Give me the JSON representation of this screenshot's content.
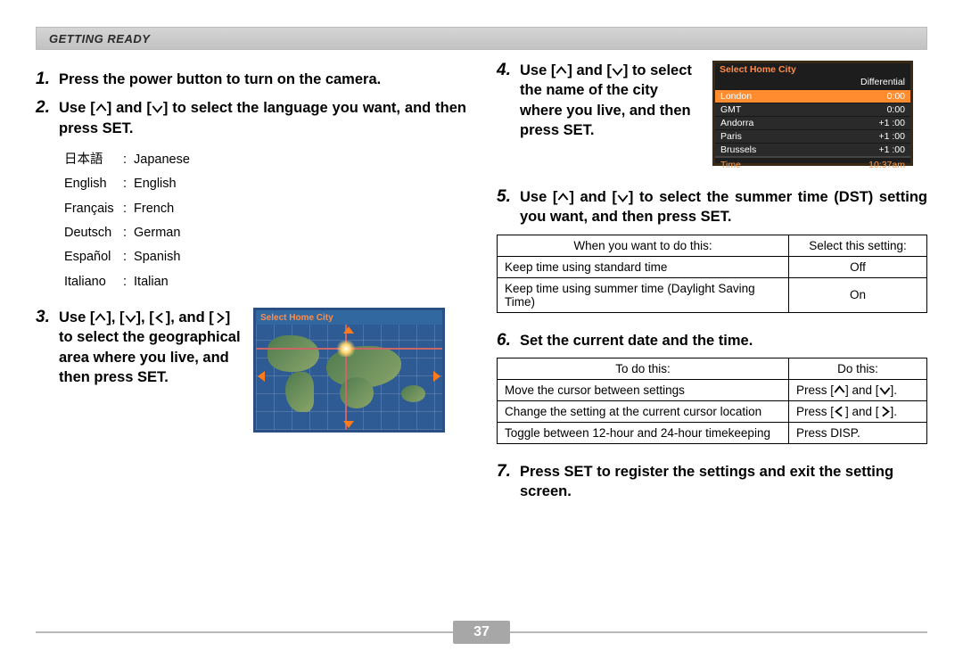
{
  "header": {
    "section_title": "GETTING READY"
  },
  "page_number": "37",
  "glyphs": {
    "up": "∧",
    "down": "∨",
    "left": "〈",
    "right": "〉"
  },
  "left": {
    "step1": {
      "num": "1.",
      "text": "Press the power button to turn on the camera."
    },
    "step2": {
      "num": "2.",
      "prefix": "Use [",
      "mid1": "] and [",
      "suffix": "] to select the language you want, and then press SET."
    },
    "languages": [
      {
        "native": "日本語",
        "english": "Japanese"
      },
      {
        "native": "English",
        "english": "English"
      },
      {
        "native": "Français",
        "english": "French"
      },
      {
        "native": "Deutsch",
        "english": "German"
      },
      {
        "native": "Español",
        "english": "Spanish"
      },
      {
        "native": "Italiano",
        "english": "Italian"
      }
    ],
    "step3": {
      "num": "3.",
      "t1": "Use [",
      "t2": "], [",
      "t3": "], [",
      "t4": "], and [",
      "t5": "] to select the geographical area where you live, and then press SET."
    },
    "map": {
      "title": "Select Home City"
    }
  },
  "right": {
    "step4": {
      "num": "4.",
      "t1": "Use [",
      "t2": "] and [",
      "t3": "] to select the name of the city where you live, and then press SET."
    },
    "city_screen": {
      "title": "Select Home City",
      "header": "Differential",
      "rows": [
        {
          "city": "London",
          "diff": "0:00",
          "sel": true
        },
        {
          "city": "GMT",
          "diff": "0:00",
          "sel": false
        },
        {
          "city": "Andorra",
          "diff": "+1 :00",
          "sel": false
        },
        {
          "city": "Paris",
          "diff": "+1 :00",
          "sel": false
        },
        {
          "city": "Brussels",
          "diff": "+1 :00",
          "sel": false
        }
      ],
      "time_label": "Time",
      "time_value": "10:37am"
    },
    "step5": {
      "num": "5.",
      "t1": "Use [",
      "t2": "] and [",
      "t3": "] to select the summer time (DST) setting you want, and then press SET."
    },
    "dst_table": {
      "head_a": "When you want to do this:",
      "head_b": "Select this setting:",
      "rows": [
        {
          "a": "Keep time using standard time",
          "b": "Off"
        },
        {
          "a": "Keep time using summer time (Daylight Saving Time)",
          "b": "On"
        }
      ]
    },
    "step6": {
      "num": "6.",
      "text": "Set the current date and the time."
    },
    "date_table": {
      "head_a": "To do this:",
      "head_b": "Do this:",
      "rows": [
        {
          "a": "Move the cursor between settings",
          "b_pre": "Press [",
          "b_mid": "] and [",
          "b_suf": "].",
          "dir1": "up",
          "dir2": "down"
        },
        {
          "a": "Change the setting at the current cursor location",
          "b_pre": "Press [",
          "b_mid": "] and [",
          "b_suf": "].",
          "dir1": "left",
          "dir2": "right"
        },
        {
          "a": "Toggle between 12-hour and 24-hour timekeeping",
          "b_plain": "Press DISP."
        }
      ]
    },
    "step7": {
      "num": "7.",
      "text": "Press SET to register the settings and exit the setting screen."
    }
  }
}
